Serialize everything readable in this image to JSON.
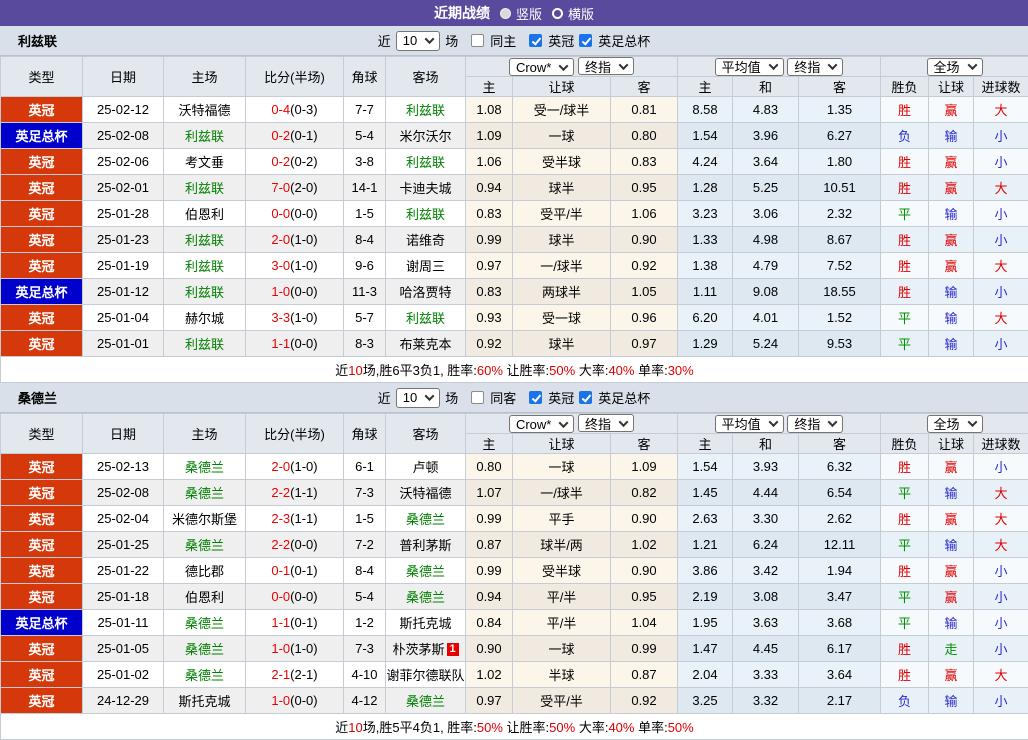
{
  "topbar": {
    "title": "近期战绩",
    "options": [
      {
        "label": "竖版",
        "selected": true
      },
      {
        "label": "横版",
        "selected": false
      }
    ]
  },
  "palette": {
    "topbar_purple": "#5A4A9E",
    "league_championship_bg": "#D5380A",
    "fa_cup_bg": "#0000CC",
    "focus_team_green": "#008000",
    "win_big_red": "#E10000",
    "lose_small_blue": "#2A2AD0",
    "draw_push_green": "#009000",
    "score_red": "#F00000"
  },
  "filter": {
    "near": "近",
    "count": "10",
    "games": "场",
    "leagues": [
      "英冠",
      "英足总杯"
    ]
  },
  "columns": {
    "type": "类型",
    "date": "日期",
    "home": "主场",
    "score": "比分(半场)",
    "corner": "角球",
    "away": "客场",
    "group1": {
      "dd1": "Crow*",
      "dd2": "终指",
      "sub": [
        "主",
        "让球",
        "客"
      ]
    },
    "group2": {
      "dd1": "平均值",
      "dd2": "终指",
      "sub": [
        "主",
        "和",
        "客"
      ]
    },
    "group3": {
      "dd1": "全场",
      "sub": [
        "胜负",
        "让球",
        "进球数"
      ]
    }
  },
  "tables": [
    {
      "team": "利兹联",
      "same_side_label": "同主",
      "rows": [
        {
          "type": "英冠",
          "date": "25-02-12",
          "home": "沃特福德",
          "away": "利兹联",
          "focus": "away",
          "score": "0-4",
          "half": "(0-3)",
          "corner": "7-7",
          "o1": "1.08",
          "hc": "受一/球半",
          "o2": "0.81",
          "a1": "8.58",
          "a2": "4.83",
          "a3": "1.35",
          "r1": "胜",
          "r2": "赢",
          "r3": "大"
        },
        {
          "type": "英足总杯",
          "date": "25-02-08",
          "home": "利兹联",
          "away": "米尔沃尔",
          "focus": "home",
          "score": "0-2",
          "half": "(0-1)",
          "corner": "5-4",
          "o1": "1.09",
          "hc": "一球",
          "o2": "0.80",
          "a1": "1.54",
          "a2": "3.96",
          "a3": "6.27",
          "r1": "负",
          "r2": "输",
          "r3": "小"
        },
        {
          "type": "英冠",
          "date": "25-02-06",
          "home": "考文垂",
          "away": "利兹联",
          "focus": "away",
          "score": "0-2",
          "half": "(0-2)",
          "corner": "3-8",
          "o1": "1.06",
          "hc": "受半球",
          "o2": "0.83",
          "a1": "4.24",
          "a2": "3.64",
          "a3": "1.80",
          "r1": "胜",
          "r2": "赢",
          "r3": "小"
        },
        {
          "type": "英冠",
          "date": "25-02-01",
          "home": "利兹联",
          "away": "卡迪夫城",
          "focus": "home",
          "score": "7-0",
          "half": "(2-0)",
          "corner": "14-1",
          "o1": "0.94",
          "hc": "球半",
          "o2": "0.95",
          "a1": "1.28",
          "a2": "5.25",
          "a3": "10.51",
          "r1": "胜",
          "r2": "赢",
          "r3": "大"
        },
        {
          "type": "英冠",
          "date": "25-01-28",
          "home": "伯恩利",
          "away": "利兹联",
          "focus": "away",
          "score": "0-0",
          "half": "(0-0)",
          "corner": "1-5",
          "o1": "0.83",
          "hc": "受平/半",
          "o2": "1.06",
          "a1": "3.23",
          "a2": "3.06",
          "a3": "2.32",
          "r1": "平",
          "r2": "输",
          "r3": "小"
        },
        {
          "type": "英冠",
          "date": "25-01-23",
          "home": "利兹联",
          "away": "诺维奇",
          "focus": "home",
          "score": "2-0",
          "half": "(1-0)",
          "corner": "8-4",
          "o1": "0.99",
          "hc": "球半",
          "o2": "0.90",
          "a1": "1.33",
          "a2": "4.98",
          "a3": "8.67",
          "r1": "胜",
          "r2": "赢",
          "r3": "小"
        },
        {
          "type": "英冠",
          "date": "25-01-19",
          "home": "利兹联",
          "away": "谢周三",
          "focus": "home",
          "score": "3-0",
          "half": "(1-0)",
          "corner": "9-6",
          "o1": "0.97",
          "hc": "一/球半",
          "o2": "0.92",
          "a1": "1.38",
          "a2": "4.79",
          "a3": "7.52",
          "r1": "胜",
          "r2": "赢",
          "r3": "大"
        },
        {
          "type": "英足总杯",
          "date": "25-01-12",
          "home": "利兹联",
          "away": "哈洛贾特",
          "focus": "home",
          "score": "1-0",
          "half": "(0-0)",
          "corner": "11-3",
          "o1": "0.83",
          "hc": "两球半",
          "o2": "1.05",
          "a1": "1.11",
          "a2": "9.08",
          "a3": "18.55",
          "r1": "胜",
          "r2": "输",
          "r3": "小"
        },
        {
          "type": "英冠",
          "date": "25-01-04",
          "home": "赫尔城",
          "away": "利兹联",
          "focus": "away",
          "score": "3-3",
          "half": "(1-0)",
          "corner": "5-7",
          "o1": "0.93",
          "hc": "受一球",
          "o2": "0.96",
          "a1": "6.20",
          "a2": "4.01",
          "a3": "1.52",
          "r1": "平",
          "r2": "输",
          "r3": "大"
        },
        {
          "type": "英冠",
          "date": "25-01-01",
          "home": "利兹联",
          "away": "布莱克本",
          "focus": "home",
          "score": "1-1",
          "half": "(0-0)",
          "corner": "8-3",
          "o1": "0.92",
          "hc": "球半",
          "o2": "0.97",
          "a1": "1.29",
          "a2": "5.24",
          "a3": "9.53",
          "r1": "平",
          "r2": "输",
          "r3": "小"
        }
      ],
      "summary": [
        [
          "近",
          false
        ],
        [
          "10",
          true
        ],
        [
          "场,胜6平3负1, 胜率:",
          false
        ],
        [
          "60%",
          true
        ],
        [
          " 让胜率:",
          false
        ],
        [
          "50%",
          true
        ],
        [
          " 大率:",
          false
        ],
        [
          "40%",
          true
        ],
        [
          " 单率:",
          false
        ],
        [
          "30%",
          true
        ]
      ]
    },
    {
      "team": "桑德兰",
      "same_side_label": "同客",
      "rows": [
        {
          "type": "英冠",
          "date": "25-02-13",
          "home": "桑德兰",
          "away": "卢顿",
          "focus": "home",
          "score": "2-0",
          "half": "(1-0)",
          "corner": "6-1",
          "o1": "0.80",
          "hc": "一球",
          "o2": "1.09",
          "a1": "1.54",
          "a2": "3.93",
          "a3": "6.32",
          "r1": "胜",
          "r2": "赢",
          "r3": "小"
        },
        {
          "type": "英冠",
          "date": "25-02-08",
          "home": "桑德兰",
          "away": "沃特福德",
          "focus": "home",
          "score": "2-2",
          "half": "(1-1)",
          "corner": "7-3",
          "o1": "1.07",
          "hc": "一/球半",
          "o2": "0.82",
          "a1": "1.45",
          "a2": "4.44",
          "a3": "6.54",
          "r1": "平",
          "r2": "输",
          "r3": "大"
        },
        {
          "type": "英冠",
          "date": "25-02-04",
          "home": "米德尔斯堡",
          "away": "桑德兰",
          "focus": "away",
          "score": "2-3",
          "half": "(1-1)",
          "corner": "1-5",
          "o1": "0.99",
          "hc": "平手",
          "o2": "0.90",
          "a1": "2.63",
          "a2": "3.30",
          "a3": "2.62",
          "r1": "胜",
          "r2": "赢",
          "r3": "大"
        },
        {
          "type": "英冠",
          "date": "25-01-25",
          "home": "桑德兰",
          "away": "普利茅斯",
          "focus": "home",
          "score": "2-2",
          "half": "(0-0)",
          "corner": "7-2",
          "o1": "0.87",
          "hc": "球半/两",
          "o2": "1.02",
          "a1": "1.21",
          "a2": "6.24",
          "a3": "12.11",
          "r1": "平",
          "r2": "输",
          "r3": "大"
        },
        {
          "type": "英冠",
          "date": "25-01-22",
          "home": "德比郡",
          "away": "桑德兰",
          "focus": "away",
          "score": "0-1",
          "half": "(0-1)",
          "corner": "8-4",
          "o1": "0.99",
          "hc": "受半球",
          "o2": "0.90",
          "a1": "3.86",
          "a2": "3.42",
          "a3": "1.94",
          "r1": "胜",
          "r2": "赢",
          "r3": "小"
        },
        {
          "type": "英冠",
          "date": "25-01-18",
          "home": "伯恩利",
          "away": "桑德兰",
          "focus": "away",
          "score": "0-0",
          "half": "(0-0)",
          "corner": "5-4",
          "o1": "0.94",
          "hc": "平/半",
          "o2": "0.95",
          "a1": "2.19",
          "a2": "3.08",
          "a3": "3.47",
          "r1": "平",
          "r2": "赢",
          "r3": "小"
        },
        {
          "type": "英足总杯",
          "date": "25-01-11",
          "home": "桑德兰",
          "away": "斯托克城",
          "focus": "home",
          "score": "1-1",
          "half": "(0-1)",
          "corner": "1-2",
          "o1": "0.84",
          "hc": "平/半",
          "o2": "1.04",
          "a1": "1.95",
          "a2": "3.63",
          "a3": "3.68",
          "r1": "平",
          "r2": "输",
          "r3": "小"
        },
        {
          "type": "英冠",
          "date": "25-01-05",
          "home": "桑德兰",
          "away": "朴茨茅斯",
          "away_badge": "1",
          "focus": "home",
          "score": "1-0",
          "half": "(1-0)",
          "corner": "7-3",
          "o1": "0.90",
          "hc": "一球",
          "o2": "0.99",
          "a1": "1.47",
          "a2": "4.45",
          "a3": "6.17",
          "r1": "胜",
          "r2": "走",
          "r3": "小"
        },
        {
          "type": "英冠",
          "date": "25-01-02",
          "home": "桑德兰",
          "away": "谢菲尔德联队",
          "focus": "home",
          "score": "2-1",
          "half": "(2-1)",
          "corner": "4-10",
          "o1": "1.02",
          "hc": "半球",
          "o2": "0.87",
          "a1": "2.04",
          "a2": "3.33",
          "a3": "3.64",
          "r1": "胜",
          "r2": "赢",
          "r3": "大"
        },
        {
          "type": "英冠",
          "date": "24-12-29",
          "home": "斯托克城",
          "away": "桑德兰",
          "focus": "away",
          "score": "1-0",
          "half": "(0-0)",
          "corner": "4-12",
          "o1": "0.97",
          "hc": "受平/半",
          "o2": "0.92",
          "a1": "3.25",
          "a2": "3.32",
          "a3": "2.17",
          "r1": "负",
          "r2": "输",
          "r3": "小"
        }
      ],
      "summary": [
        [
          "近",
          false
        ],
        [
          "10",
          true
        ],
        [
          "场,胜5平4负1, 胜率:",
          false
        ],
        [
          "50%",
          true
        ],
        [
          " 让胜率:",
          false
        ],
        [
          "50%",
          true
        ],
        [
          " 大率:",
          false
        ],
        [
          "40%",
          true
        ],
        [
          " 单率:",
          false
        ],
        [
          "50%",
          true
        ]
      ]
    }
  ]
}
